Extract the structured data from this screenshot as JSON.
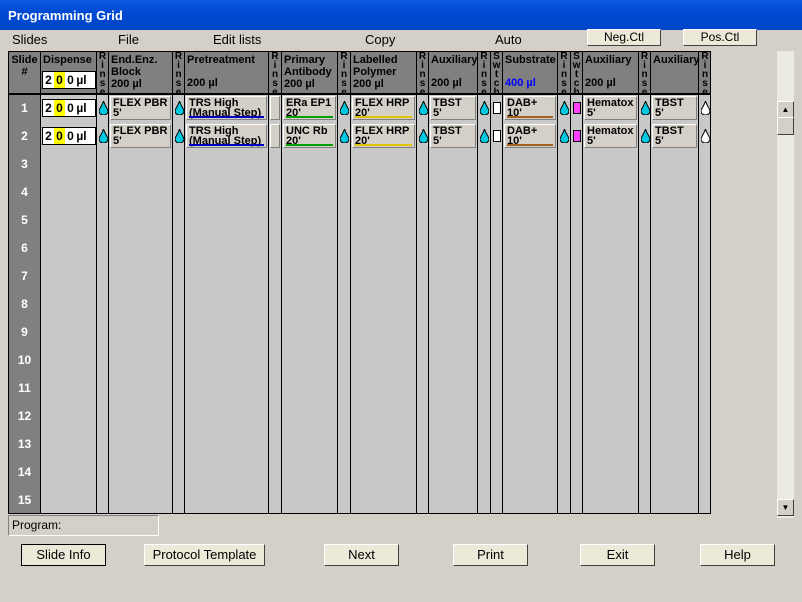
{
  "window": {
    "title": "Programming Grid"
  },
  "menu": {
    "slides": "Slides",
    "file": "File",
    "edit_lists": "Edit lists",
    "copy": "Copy",
    "auto": "Auto"
  },
  "controls": {
    "neg": "Neg.Ctl",
    "pos": "Pos.Ctl"
  },
  "headers": {
    "slide": "Slide #",
    "dispense": "Dispense",
    "end_enz": "End.Enz. Block",
    "end_enz_vol": "200 µl",
    "pretreatment": "Pretreatment",
    "pretreatment_vol": "200 µl",
    "primary": "Primary Antibody",
    "primary_vol": "200 µl",
    "labelled": "Labelled Polymer",
    "labelled_vol": "200 µl",
    "aux1": "Auxiliary",
    "aux1_vol": "200 µl",
    "substrate": "Substrate",
    "substrate_vol": "400 µl",
    "aux2": "Auxiliary",
    "aux2_vol": "200 µl",
    "aux3": "Auxiliary",
    "rinse": "Rinse",
    "switch": "Swtch"
  },
  "rows": [
    {
      "num": "1",
      "dispense": [
        "2",
        "0",
        "0",
        "µl"
      ],
      "end_enz": [
        "FLEX PBR",
        "5'"
      ],
      "pretreat": [
        "TRS High",
        "(Manual Step)"
      ],
      "primary": [
        "ERa EP1",
        "20'"
      ],
      "labelled": [
        "FLEX HRP",
        "20'"
      ],
      "aux1": [
        "TBST",
        "5'"
      ],
      "substrate": [
        "DAB+",
        "10'"
      ],
      "aux2": [
        "Hematox",
        "5'"
      ],
      "aux3": [
        "TBST",
        "5'"
      ]
    },
    {
      "num": "2",
      "dispense": [
        "2",
        "0",
        "0",
        "µl"
      ],
      "end_enz": [
        "FLEX PBR",
        "5'"
      ],
      "pretreat": [
        "TRS High",
        "(Manual Step)"
      ],
      "primary": [
        "UNC Rb",
        "20'"
      ],
      "labelled": [
        "FLEX HRP",
        "20'"
      ],
      "aux1": [
        "TBST",
        "5'"
      ],
      "substrate": [
        "DAB+",
        "10'"
      ],
      "aux2": [
        "Hematox",
        "5'"
      ],
      "aux3": [
        "TBST",
        "5'"
      ]
    }
  ],
  "empty_rows": [
    "3",
    "4",
    "5",
    "6",
    "7",
    "8",
    "9",
    "10",
    "11",
    "12",
    "13",
    "14",
    "15"
  ],
  "program": {
    "label": "Program:"
  },
  "buttons": {
    "slide_info": "Slide Info",
    "protocol_template": "Protocol Template",
    "next": "Next",
    "print": "Print",
    "exit": "Exit",
    "help": "Help"
  },
  "colors": {
    "primary_bar": "#00a000",
    "labelled_bar": "#e0c000",
    "pretreat_bar": "#0000c0",
    "substrate_bar": "#a06020",
    "drop": "#00c8e0",
    "substrate_vol": "#0000ff"
  }
}
